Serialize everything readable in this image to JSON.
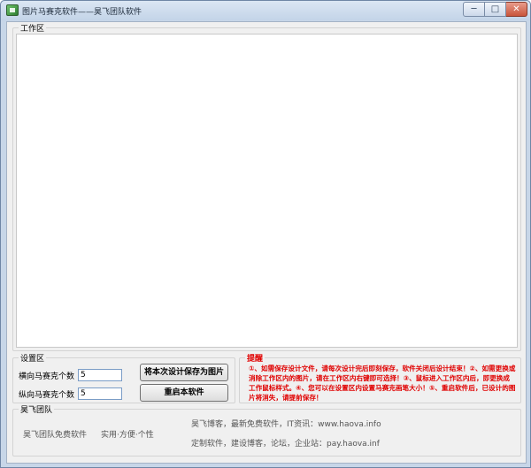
{
  "window": {
    "title": "图片马赛克软件——昊飞团队软件",
    "controls": {
      "minimize": "─",
      "maximize": "□",
      "close": "✕"
    }
  },
  "workarea": {
    "label": "工作区"
  },
  "settings": {
    "label": "设置区",
    "horizontal_label": "横向马赛克个数",
    "horizontal_value": "5",
    "vertical_label": "纵向马赛克个数",
    "vertical_value": "5",
    "save_button": "将本次设计保存为图片",
    "restart_button": "重启本软件"
  },
  "reminder": {
    "label": "提醒",
    "text": "①、如需保存设计文件，请每次设计完后即刻保存，软件关闭后设计结束！②、如需更换或消除工作区内的图片，请在工作区内右键即可选择！③、鼠标进入工作区内后，即更换成工作鼠标样式。④、您可以在设置区内设置马赛克画笔大小！⑤、重启软件后，已设计的图片将消失，请提前保存！"
  },
  "team": {
    "label": "昊飞团队",
    "left_text1": "昊飞团队免费软件",
    "left_text2": "实用·方便·个性",
    "line1": "昊飞博客，最新免费软件，IT资讯：www.haova.info",
    "line2": "定制软件，建设博客，论坛，企业站：pay.haova.inf"
  },
  "colors": {
    "accent_red": "#e00000",
    "title_bar": "#c3d4e8"
  }
}
